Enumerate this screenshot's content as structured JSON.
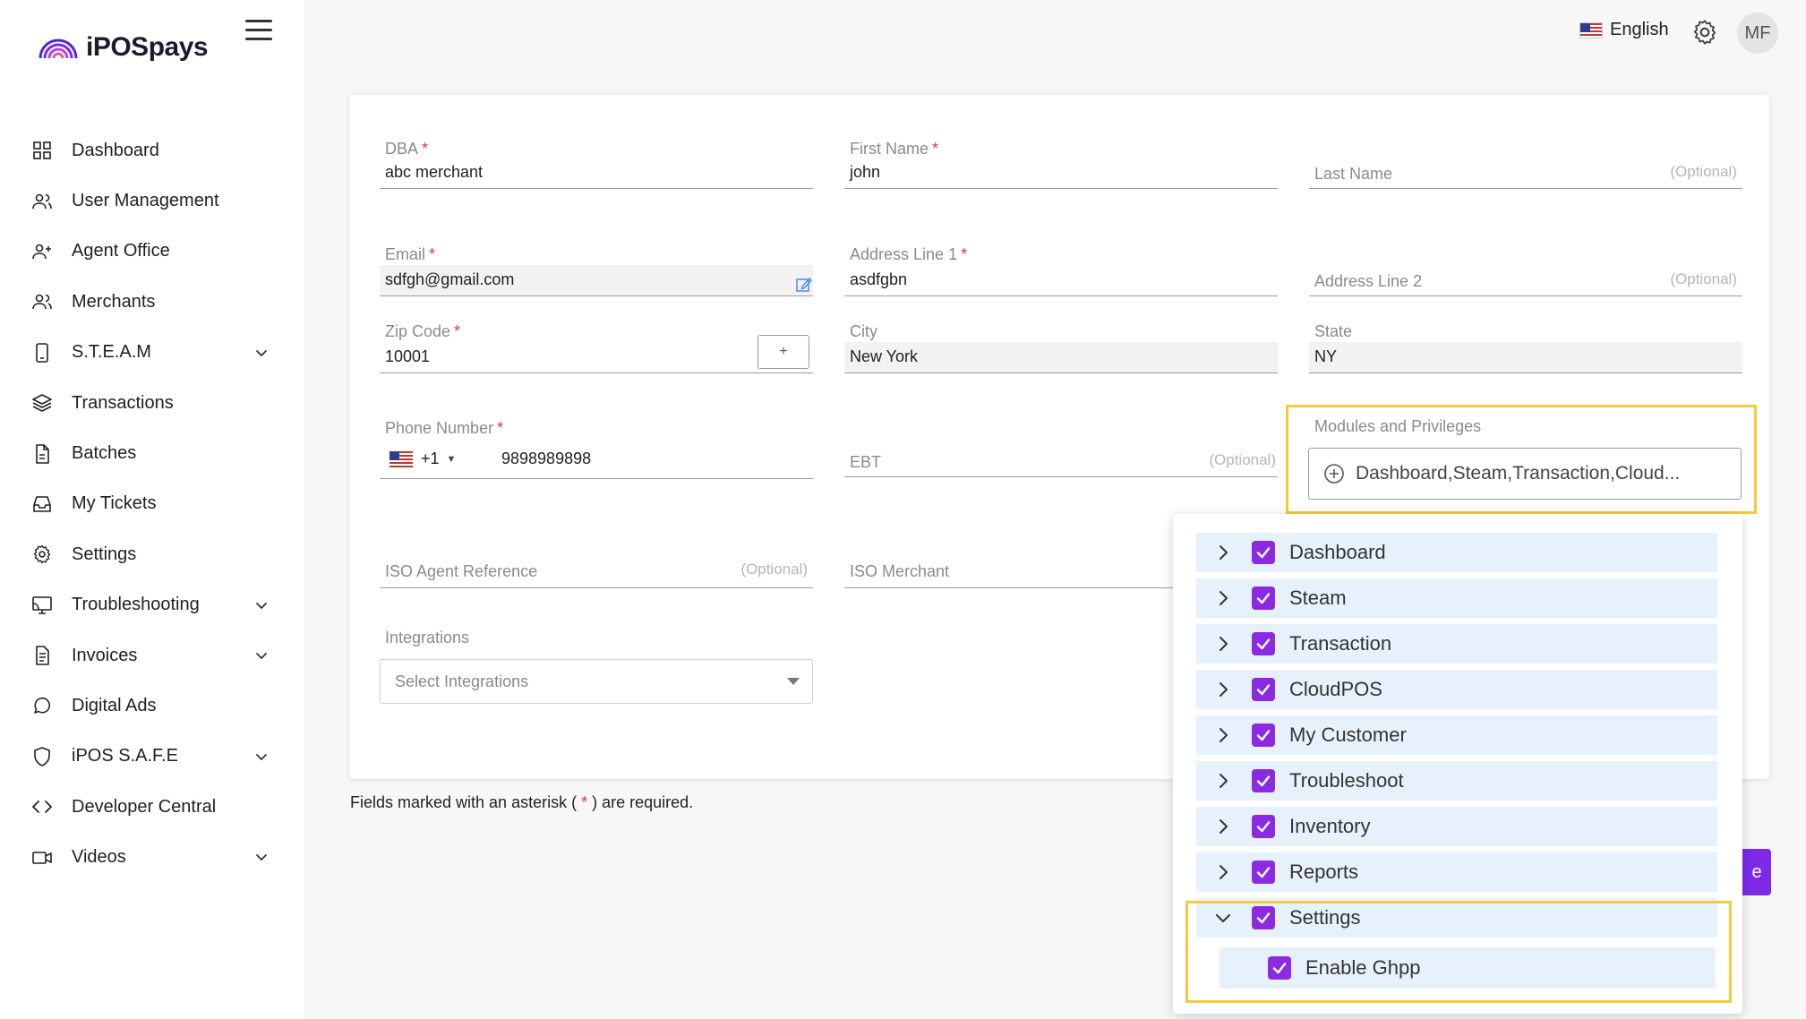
{
  "brand": {
    "name": "iPOSpays",
    "accent": "#7c2ae8"
  },
  "sidebar": {
    "items": [
      {
        "label": "Dashboard",
        "icon": "grid-icon",
        "expandable": false
      },
      {
        "label": "User Management",
        "icon": "users-icon",
        "expandable": false
      },
      {
        "label": "Agent Office",
        "icon": "user-plus-icon",
        "expandable": false
      },
      {
        "label": "Merchants",
        "icon": "merchants-icon",
        "expandable": false
      },
      {
        "label": "S.T.E.A.M",
        "icon": "device-icon",
        "expandable": true
      },
      {
        "label": "Transactions",
        "icon": "layers-icon",
        "expandable": false
      },
      {
        "label": "Batches",
        "icon": "file-icon",
        "expandable": false
      },
      {
        "label": "My Tickets",
        "icon": "inbox-icon",
        "expandable": false
      },
      {
        "label": "Settings",
        "icon": "gear-icon",
        "expandable": false
      },
      {
        "label": "Troubleshooting",
        "icon": "monitor-icon",
        "expandable": true
      },
      {
        "label": "Invoices",
        "icon": "invoice-icon",
        "expandable": true
      },
      {
        "label": "Digital Ads",
        "icon": "chat-icon",
        "expandable": false
      },
      {
        "label": "iPOS S.A.F.E",
        "icon": "shield-icon",
        "expandable": true
      },
      {
        "label": "Developer Central",
        "icon": "code-icon",
        "expandable": false
      },
      {
        "label": "Videos",
        "icon": "video-icon",
        "expandable": true
      }
    ]
  },
  "topbar": {
    "language": "English",
    "avatar_initials": "MF"
  },
  "form": {
    "dba": {
      "label": "DBA",
      "value": "abc merchant"
    },
    "first_name": {
      "label": "First Name",
      "value": "john"
    },
    "last_name": {
      "label": "Last Name",
      "optional": "(Optional)"
    },
    "email": {
      "label": "Email",
      "value": "sdfgh@gmail.com"
    },
    "address1": {
      "label": "Address Line 1",
      "value": "asdfgbn"
    },
    "address2": {
      "label": "Address Line 2",
      "optional": "(Optional)"
    },
    "zip": {
      "label": "Zip Code",
      "value": "10001",
      "button": "+"
    },
    "city": {
      "label": "City",
      "value": "New York"
    },
    "state": {
      "label": "State",
      "value": "NY"
    },
    "phone": {
      "label": "Phone Number",
      "code": "+1",
      "value": "9898989898"
    },
    "ebt": {
      "label": "EBT",
      "optional": "(Optional)"
    },
    "modules": {
      "label": "Modules and Privileges",
      "value": "Dashboard,Steam,Transaction,Cloud..."
    },
    "iso_agent": {
      "label": "ISO Agent Reference",
      "optional": "(Optional)"
    },
    "iso_merchant": {
      "label": "ISO Merchant"
    },
    "integrations": {
      "label": "Integrations",
      "placeholder": "Select Integrations"
    }
  },
  "note": {
    "before": "Fields marked with an asterisk ( ",
    "star": "*",
    "after": " ) are required."
  },
  "modules_tree": {
    "items": [
      {
        "label": "Dashboard",
        "checked": true,
        "expanded": false
      },
      {
        "label": "Steam",
        "checked": true,
        "expanded": false
      },
      {
        "label": "Transaction",
        "checked": true,
        "expanded": false
      },
      {
        "label": "CloudPOS",
        "checked": true,
        "expanded": false
      },
      {
        "label": "My Customer",
        "checked": true,
        "expanded": false
      },
      {
        "label": "Troubleshoot",
        "checked": true,
        "expanded": false
      },
      {
        "label": "Inventory",
        "checked": true,
        "expanded": false
      },
      {
        "label": "Reports",
        "checked": true,
        "expanded": false
      },
      {
        "label": "Settings",
        "checked": true,
        "expanded": true
      }
    ],
    "settings_children": [
      {
        "label": "Enable Ghpp",
        "checked": true
      }
    ]
  },
  "save_button": {
    "label": "e"
  }
}
